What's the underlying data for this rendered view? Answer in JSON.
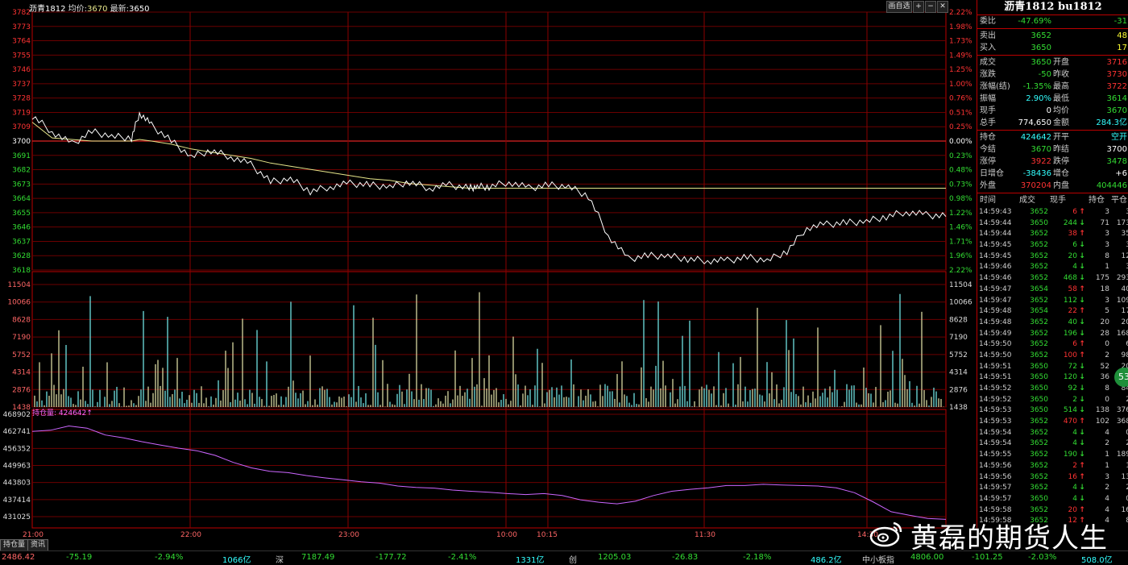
{
  "header": {
    "symbol": "沥青1812",
    "avg_label": "均价:",
    "avg_value": "3670",
    "last_label": "最新:",
    "last_value": "3650",
    "buttons": {
      "drawing": "画自选",
      "plus": "+",
      "minus": "−",
      "close": "✕"
    }
  },
  "price_axis": {
    "left": [
      "3782",
      "3773",
      "3764",
      "3755",
      "3746",
      "3737",
      "3728",
      "3719",
      "3709",
      "3700",
      "3691",
      "3682",
      "3673",
      "3664",
      "3655",
      "3646",
      "3637",
      "3628",
      "3618"
    ],
    "right": [
      "2.22%",
      "1.98%",
      "1.73%",
      "1.49%",
      "1.25%",
      "1.00%",
      "0.76%",
      "0.51%",
      "0.25%",
      "0.00%",
      "0.23%",
      "0.48%",
      "0.73%",
      "0.98%",
      "1.22%",
      "1.46%",
      "1.71%",
      "1.96%",
      "2.22%"
    ]
  },
  "volume_axis": [
    "11504",
    "10066",
    "8628",
    "7190",
    "5752",
    "4314",
    "2876",
    "1438"
  ],
  "oi_axis": [
    "468902",
    "462741",
    "456352",
    "449963",
    "443803",
    "437414",
    "431025"
  ],
  "oi_label": "持仓量: 424642↑",
  "time_axis": [
    "21:00",
    "22:00",
    "23:00",
    "10:00",
    "10:15",
    "11:30",
    "14:30"
  ],
  "chart_data": {
    "type": "line",
    "price": {
      "x_index": [
        0,
        5,
        10,
        15,
        20,
        25,
        27,
        30,
        35,
        40,
        45,
        50,
        55,
        60,
        65,
        70,
        75,
        80,
        85,
        90,
        95,
        100,
        105,
        110,
        112,
        115,
        120,
        125,
        130,
        135,
        140,
        145,
        150,
        155,
        160,
        165,
        170,
        175,
        180,
        185,
        190,
        195,
        200,
        205,
        210,
        215,
        220,
        225,
        230
      ],
      "values": [
        3716,
        3706,
        3698,
        3706,
        3703,
        3702,
        3718,
        3710,
        3700,
        3690,
        3694,
        3690,
        3685,
        3674,
        3676,
        3668,
        3671,
        3673,
        3672,
        3671,
        3674,
        3670,
        3672,
        3670,
        3671,
        3671,
        3674,
        3670,
        3672,
        3671,
        3665,
        3640,
        3625,
        3627,
        3627,
        3625,
        3624,
        3624,
        3626,
        3624,
        3630,
        3645,
        3647,
        3648,
        3649,
        3652,
        3655,
        3653,
        3652
      ],
      "avg_values": [
        3712,
        3702,
        3701,
        3700,
        3700,
        3700,
        3701,
        3700,
        3698,
        3695,
        3693,
        3691,
        3689,
        3686,
        3684,
        3682,
        3680,
        3678,
        3676,
        3675,
        3673,
        3672,
        3671,
        3670,
        3670,
        3670,
        3670,
        3670,
        3670,
        3670,
        3670,
        3670,
        3670,
        3670,
        3670,
        3670,
        3670,
        3670,
        3670,
        3670,
        3670,
        3670,
        3670,
        3670,
        3670,
        3670,
        3670,
        3670,
        3670
      ],
      "ylim": [
        3618,
        3782
      ]
    },
    "oi": {
      "values": [
        465500,
        466000,
        467800,
        466900,
        464000,
        462800,
        461200,
        459800,
        458500,
        457400,
        455500,
        452500,
        450200,
        448800,
        448200,
        447000,
        446000,
        445200,
        444400,
        443800,
        442600,
        442000,
        441700,
        440900,
        440400,
        440000,
        439400,
        439000,
        439400,
        438600,
        436800,
        435800,
        435100,
        436200,
        438600,
        440400,
        441200,
        441800,
        442800,
        442800,
        443300,
        443000,
        442800,
        442600,
        441800,
        439800,
        436000,
        431800,
        430300,
        429000,
        428600
      ],
      "ylim": [
        425000,
        470000
      ]
    }
  },
  "panel": {
    "title": "沥青1812 bu1812",
    "weibi": {
      "label": "委比",
      "value": "-47.69%",
      "diff": "-31"
    },
    "sell": {
      "label": "卖出",
      "price": "3652",
      "vol": "48"
    },
    "buy": {
      "label": "买入",
      "price": "3650",
      "vol": "17"
    },
    "stats": [
      {
        "l1": "成交",
        "v1": "3650",
        "c1": "dn",
        "l2": "开盘",
        "v2": "3716",
        "c2": "up"
      },
      {
        "l1": "涨跌",
        "v1": "-50",
        "c1": "dn",
        "l2": "昨收",
        "v2": "3730",
        "c2": "up"
      },
      {
        "l1": "涨幅(结)",
        "v1": "-1.35%",
        "c1": "dn",
        "l2": "最高",
        "v2": "3722",
        "c2": "up"
      },
      {
        "l1": "振幅",
        "v1": "2.90%",
        "c1": "cy",
        "l2": "最低",
        "v2": "3614",
        "c2": "dn"
      },
      {
        "l1": "现手",
        "v1": "0",
        "c1": "wh",
        "l2": "均价",
        "v2": "3670",
        "c2": "dn"
      },
      {
        "l1": "总手",
        "v1": "774,650",
        "c1": "wh",
        "l2": "金额",
        "v2": "284.3亿",
        "c2": "cy"
      }
    ],
    "stats2": [
      {
        "l1": "持仓",
        "v1": "424642",
        "c1": "cy",
        "l2": "开平",
        "v2": "空开",
        "c2": "cy"
      },
      {
        "l1": "今结",
        "v1": "3670",
        "c1": "dn",
        "l2": "昨结",
        "v2": "3700",
        "c2": "wh"
      },
      {
        "l1": "涨停",
        "v1": "3922",
        "c1": "up",
        "l2": "跌停",
        "v2": "3478",
        "c2": "dn"
      },
      {
        "l1": "日增仓",
        "v1": "-38436",
        "c1": "cy",
        "l2": "增仓",
        "v2": "+6",
        "c2": "wh"
      },
      {
        "l1": "外盘",
        "v1": "370204",
        "c1": "up",
        "l2": "内盘",
        "v2": "404446",
        "c2": "dn"
      }
    ],
    "ticks_header": {
      "time": "时间",
      "price": "成交",
      "vol": "现手",
      "oi": "持仓",
      "close": "平仓"
    },
    "ticks": [
      {
        "t": "14:59:43",
        "p": "3652",
        "v": "6",
        "d": "up",
        "o": "3",
        "c": "3"
      },
      {
        "t": "14:59:44",
        "p": "3650",
        "v": "244",
        "d": "dn",
        "o": "71",
        "c": "173"
      },
      {
        "t": "14:59:44",
        "p": "3652",
        "v": "38",
        "d": "up",
        "o": "3",
        "c": "35"
      },
      {
        "t": "14:59:45",
        "p": "3652",
        "v": "6",
        "d": "dn",
        "o": "3",
        "c": "3"
      },
      {
        "t": "14:59:45",
        "p": "3652",
        "v": "20",
        "d": "dn",
        "o": "8",
        "c": "12"
      },
      {
        "t": "14:59:46",
        "p": "3652",
        "v": "4",
        "d": "dn",
        "o": "1",
        "c": "3"
      },
      {
        "t": "14:59:46",
        "p": "3652",
        "v": "468",
        "d": "dn",
        "o": "175",
        "c": "293"
      },
      {
        "t": "14:59:47",
        "p": "3654",
        "v": "58",
        "d": "up",
        "o": "18",
        "c": "40"
      },
      {
        "t": "14:59:47",
        "p": "3652",
        "v": "112",
        "d": "dn",
        "o": "3",
        "c": "109"
      },
      {
        "t": "14:59:48",
        "p": "3654",
        "v": "22",
        "d": "up",
        "o": "5",
        "c": "17"
      },
      {
        "t": "14:59:48",
        "p": "3652",
        "v": "40",
        "d": "dn",
        "o": "20",
        "c": "20"
      },
      {
        "t": "14:59:49",
        "p": "3652",
        "v": "196",
        "d": "dn",
        "o": "28",
        "c": "168"
      },
      {
        "t": "14:59:50",
        "p": "3652",
        "v": "6",
        "d": "up",
        "o": "0",
        "c": "6"
      },
      {
        "t": "14:59:50",
        "p": "3652",
        "v": "100",
        "d": "up",
        "o": "2",
        "c": "98"
      },
      {
        "t": "14:59:51",
        "p": "3650",
        "v": "72",
        "d": "dn",
        "o": "52",
        "c": "20"
      },
      {
        "t": "14:59:51",
        "p": "3650",
        "v": "120",
        "d": "dn",
        "o": "36",
        "c": "84"
      },
      {
        "t": "14:59:52",
        "p": "3650",
        "v": "92",
        "d": "dn",
        "o": "8",
        "c": "84"
      },
      {
        "t": "14:59:52",
        "p": "3650",
        "v": "2",
        "d": "dn",
        "o": "0",
        "c": "2"
      },
      {
        "t": "14:59:53",
        "p": "3650",
        "v": "514",
        "d": "dn",
        "o": "138",
        "c": "376"
      },
      {
        "t": "14:59:53",
        "p": "3652",
        "v": "470",
        "d": "up",
        "o": "102",
        "c": "368"
      },
      {
        "t": "14:59:54",
        "p": "3652",
        "v": "4",
        "d": "dn",
        "o": "4",
        "c": "0"
      },
      {
        "t": "14:59:54",
        "p": "3652",
        "v": "4",
        "d": "dn",
        "o": "2",
        "c": "2"
      },
      {
        "t": "14:59:55",
        "p": "3652",
        "v": "190",
        "d": "dn",
        "o": "1",
        "c": "189"
      },
      {
        "t": "14:59:56",
        "p": "3652",
        "v": "2",
        "d": "up",
        "o": "1",
        "c": "1"
      },
      {
        "t": "14:59:56",
        "p": "3652",
        "v": "16",
        "d": "up",
        "o": "3",
        "c": "13"
      },
      {
        "t": "14:59:57",
        "p": "3652",
        "v": "4",
        "d": "dn",
        "o": "2",
        "c": "2"
      },
      {
        "t": "14:59:57",
        "p": "3650",
        "v": "4",
        "d": "dn",
        "o": "4",
        "c": "0"
      },
      {
        "t": "14:59:58",
        "p": "3652",
        "v": "20",
        "d": "up",
        "o": "4",
        "c": "16"
      },
      {
        "t": "14:59:58",
        "p": "3652",
        "v": "12",
        "d": "up",
        "o": "4",
        "c": "8"
      }
    ],
    "badge": "53"
  },
  "bottom": {
    "tab1": "持仓量",
    "tab2": "资讯",
    "sh_val": "2486.42",
    "sh_chg": "-75.19",
    "sh_pct": "-2.94%",
    "sh_amt": "1066亿",
    "sz_name": "深",
    "sz_val": "7187.49",
    "sz_chg": "-177.72",
    "sz_pct": "-2.41%",
    "sz_amt": "1331亿",
    "cy_name": "创",
    "cy_val": "1205.03",
    "cy_chg": "-26.83",
    "cy_pct": "-2.18%",
    "cy_amt": "486.2亿",
    "zx_name": "中小板指",
    "zx_val": "4806.00",
    "zx_chg": "-101.25",
    "zx_pct": "-2.03%",
    "zx_amt": "508.0亿"
  },
  "watermark": "黄磊的期货人生",
  "colors": {
    "up": "#ff3333",
    "down": "#33dd33",
    "grid": "#8b0000",
    "price_line": "#ffffff",
    "avg_line": "#e6e68a",
    "oi_line": "#cc66ff",
    "vol_bar": "#6fe0e0"
  }
}
